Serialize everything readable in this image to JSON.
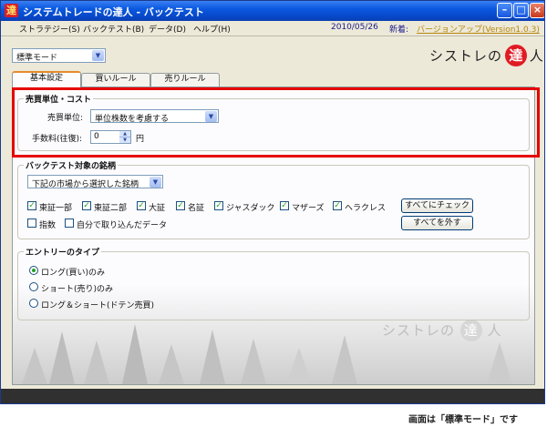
{
  "window": {
    "title": "システムトレードの達人 - バックテスト",
    "app_icon": "達"
  },
  "window_buttons": {
    "min": "–",
    "max": "□",
    "close": "×"
  },
  "menu": {
    "items": [
      "ストラテジー(S)",
      "バックテスト(B)",
      "データ(D)",
      "ヘルプ(H)"
    ],
    "date": "2010/05/26",
    "new_label": "新着:",
    "update_link": "バージョンアップ(Version1.0.3)"
  },
  "mode": {
    "selected": "標準モード"
  },
  "brand": {
    "pre": "シストレの",
    "mark": "達",
    "post": "人"
  },
  "tabs": [
    "基本設定",
    "買いルール",
    "売りルール"
  ],
  "cost_group": {
    "legend": "売買単位・コスト",
    "unit_label": "売買単位:",
    "unit_value": "単位株数を考慮する",
    "fee_label": "手数料(往復):",
    "fee_value": "0",
    "fee_unit": "円"
  },
  "stock_group": {
    "legend": "バックテスト対象の銘柄",
    "source_value": "下記の市場から選択した銘柄",
    "markets": [
      {
        "label": "東証一部",
        "checked": true
      },
      {
        "label": "東証二部",
        "checked": true
      },
      {
        "label": "大証",
        "checked": true
      },
      {
        "label": "名証",
        "checked": true
      },
      {
        "label": "ジャスダック",
        "checked": true
      },
      {
        "label": "マザーズ",
        "checked": true
      },
      {
        "label": "ヘラクレス",
        "checked": true
      }
    ],
    "extras": [
      {
        "label": "指数",
        "checked": false
      },
      {
        "label": "自分で取り込んだデータ",
        "checked": false
      }
    ],
    "check_all": "すべてにチェック",
    "uncheck_all": "すべてを外す"
  },
  "entry_group": {
    "legend": "エントリーのタイプ",
    "options": [
      {
        "label": "ロング(買い)のみ",
        "selected": true
      },
      {
        "label": "ショート(売り)のみ",
        "selected": false
      },
      {
        "label": "ロング＆ショート(ドテン売買)",
        "selected": false
      }
    ]
  },
  "watermark": {
    "pre": "シストレの",
    "mark": "達",
    "post": "人"
  },
  "caption": "画面は「標準モード」です",
  "colors": {
    "highlight": "#e60000",
    "titlebar": "#0a58e0",
    "check": "#21a121"
  }
}
